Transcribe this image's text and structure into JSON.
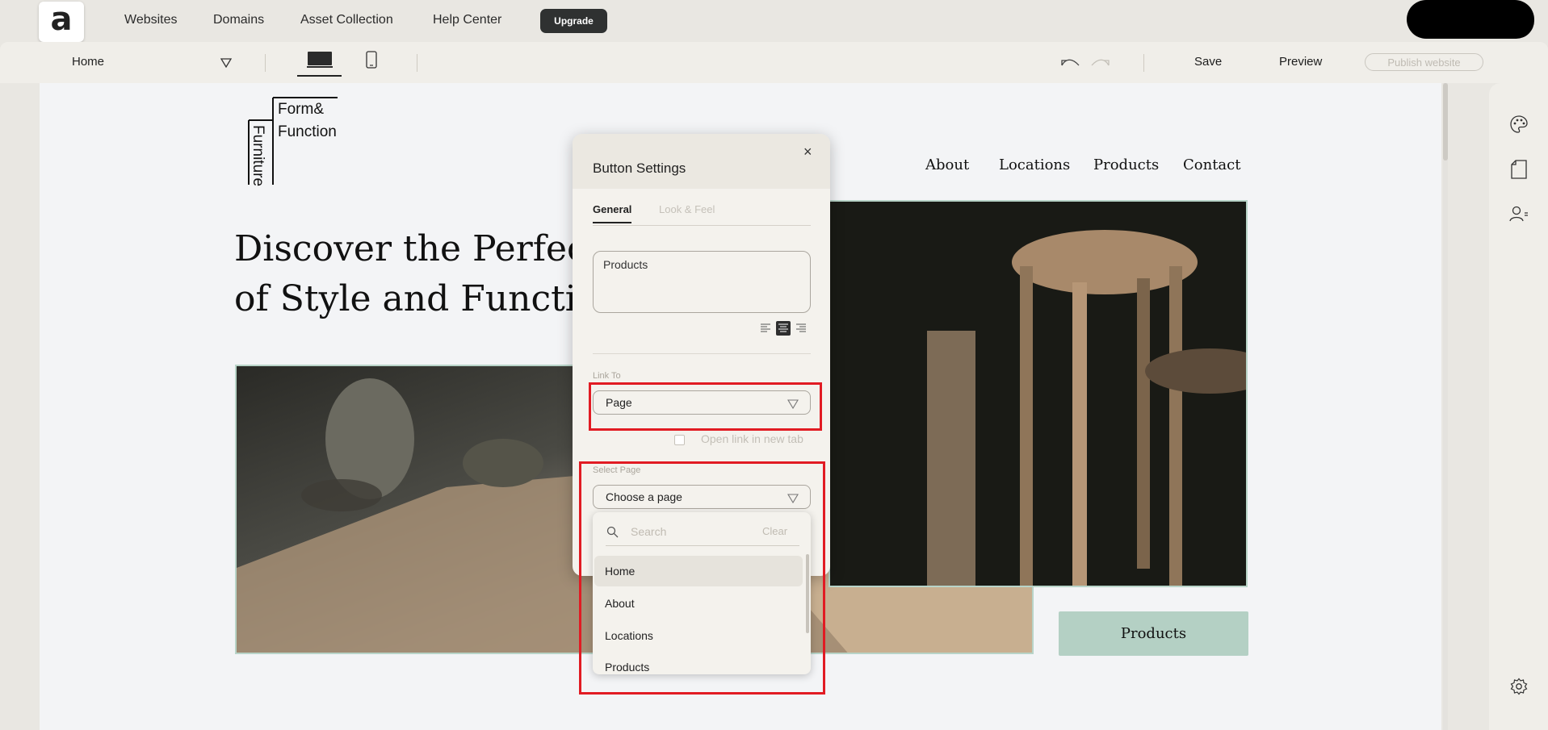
{
  "topnav": {
    "logo_glyph": "a",
    "links": [
      "Websites",
      "Domains",
      "Asset Collection",
      "Help Center"
    ],
    "upgrade": "Upgrade"
  },
  "toolbar": {
    "current_page": "Home",
    "save": "Save",
    "preview": "Preview",
    "publish": "Publish website"
  },
  "site": {
    "brand_line1": "Form&",
    "brand_line2": "Function",
    "brand_vertical": "Furniture",
    "nav": [
      "About",
      "Locations",
      "Products",
      "Contact"
    ],
    "hero_line1": "Discover the Perfect Blend",
    "hero_line2": "of Style and Function",
    "cta_button": "Products"
  },
  "panel": {
    "title": "Button Settings",
    "close_glyph": "×",
    "tabs": [
      "General",
      "Look & Feel"
    ],
    "button_text": "Products",
    "link_to_label": "Link To",
    "link_to_value": "Page",
    "new_tab_label": "Open link in new tab",
    "select_page_label": "Select Page",
    "select_page_placeholder": "Choose a page"
  },
  "dropdown": {
    "search_placeholder": "Search",
    "clear": "Clear",
    "items": [
      "Home",
      "About",
      "Locations",
      "Products"
    ],
    "selected_index": 0
  },
  "colors": {
    "accent_button": "#b4d0c4",
    "highlight": "#e11b23",
    "upgrade_bg": "#2f3131"
  }
}
